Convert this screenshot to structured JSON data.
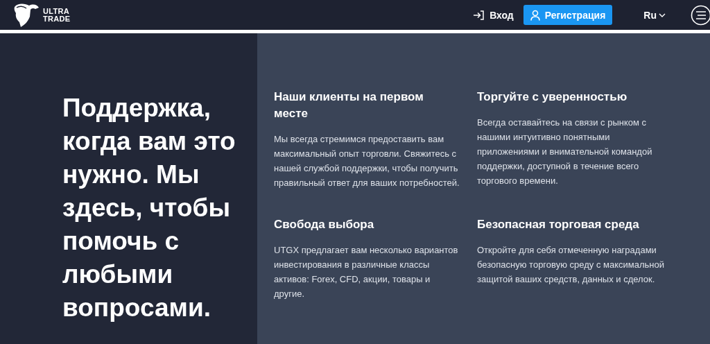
{
  "header": {
    "logo": {
      "line_1": "ULTRA",
      "line_2": "TRADE"
    },
    "login": "Вход",
    "register": "Регистрация",
    "language": "Ru"
  },
  "hero": {
    "headline": "Поддержка, когда вам это нужно. Мы здесь, чтобы помочь с любыми вопросами."
  },
  "features": [
    {
      "title": "Наши клиенты на первом месте",
      "text": "Мы всегда стремимся предоставить вам максимальный опыт торговли. Свяжитесь с нашей службой поддержки, чтобы получить правильный ответ для ваших потребностей."
    },
    {
      "title": "Торгуйте с уверенностью",
      "text": "Всегда оставайтесь на связи с рынком с нашими интуитивно понятными приложениями и внимательной командой поддержки, доступной в течение всего торгового времени."
    },
    {
      "title": "Свобода выбора",
      "text": "UTGX предлагает вам несколько вариантов инвестирования в различные классы активов: Forex, CFD, акции, товары и другие."
    },
    {
      "title": "Безопасная торговая среда",
      "text": "Откройте для себя отмеченную наградами безопасную торговую среду с максимальной защитой ваших средств, данных и сделок."
    }
  ]
}
